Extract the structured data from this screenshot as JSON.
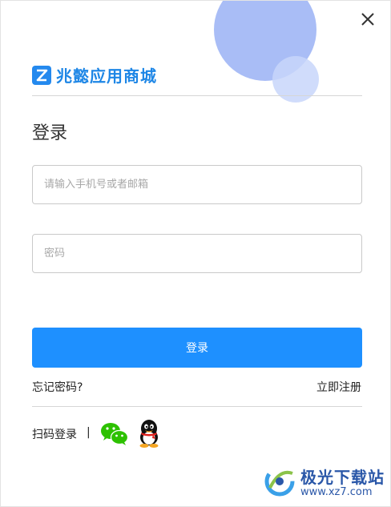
{
  "window": {
    "close_label": "close"
  },
  "brand": {
    "name": "兆懿应用商城",
    "accent": "#1d86e6"
  },
  "login": {
    "title": "登录",
    "phone_placeholder": "请输入手机号或者邮箱",
    "password_placeholder": "密码",
    "submit_label": "登录",
    "forgot_label": "忘记密码?",
    "register_label": "立即注册",
    "button_color": "#1e90ff"
  },
  "social": {
    "qr_label": "扫码登录",
    "separator": "|",
    "icons": [
      "wechat-icon",
      "qq-icon"
    ]
  },
  "watermark": {
    "name": "极光下载站",
    "url": "www.xz7.com"
  }
}
